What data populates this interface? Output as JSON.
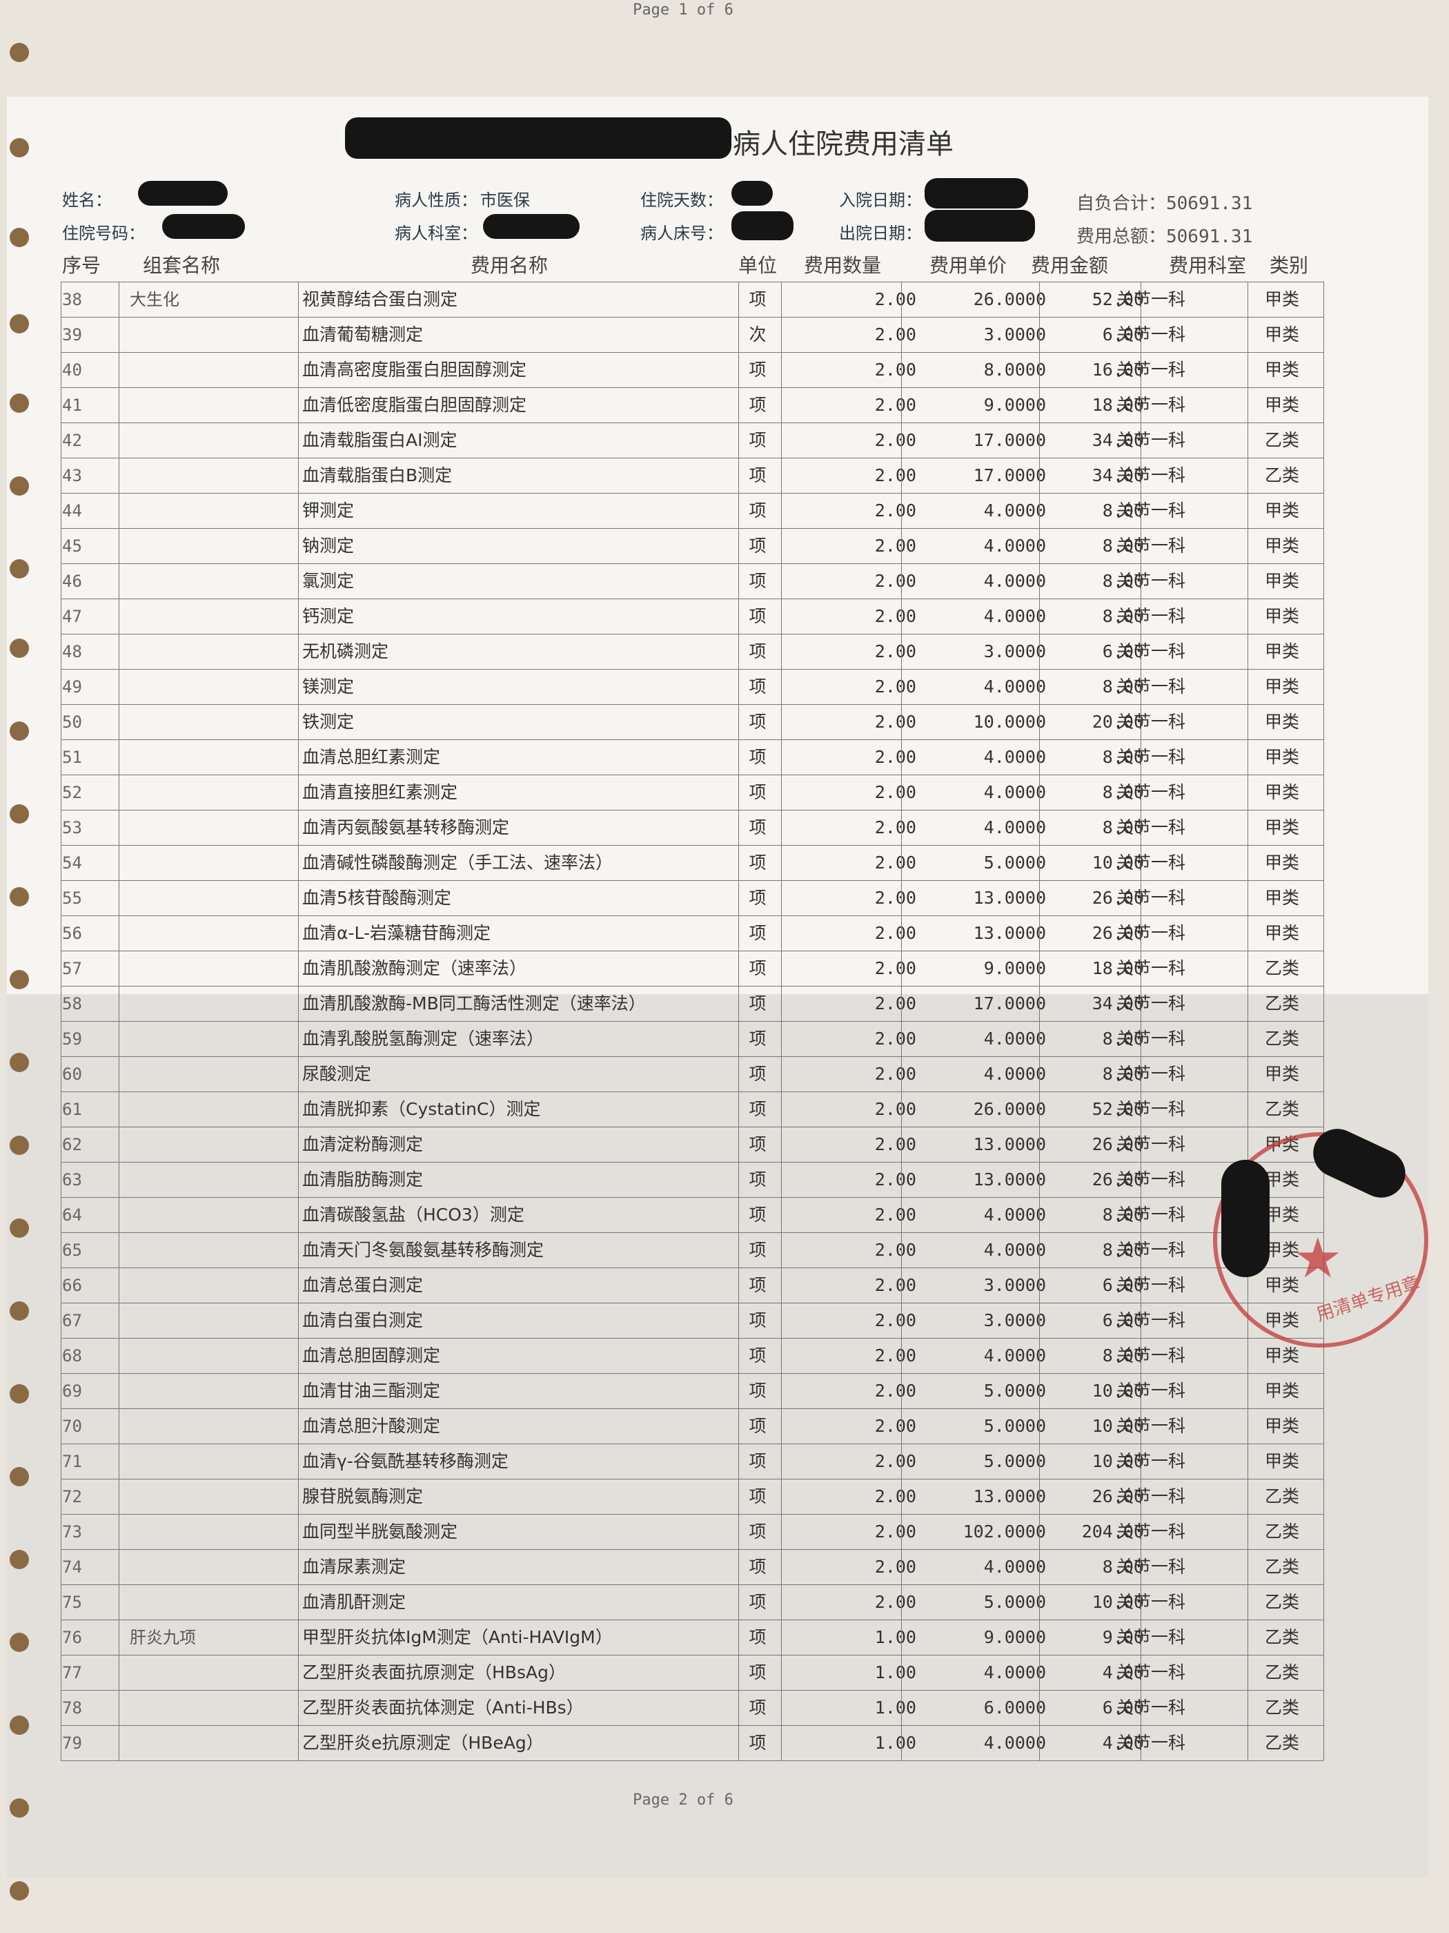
{
  "page_top": "Page 1 of 6",
  "page_bottom": "Page 2 of 6",
  "title": "病人住院费用清单",
  "header": {
    "name_label": "姓名：",
    "nature_label": "病人性质：",
    "nature_value": "市医保",
    "days_label": "住院天数：",
    "admit_label": "入院日期：",
    "self_pay": "自负合计：50691.31",
    "hospital_no_label": "住院号码：",
    "ward_label": "病人科室：",
    "bed_label": "病人床号：",
    "discharge_label": "出院日期：",
    "total": "费用总额：50691.31"
  },
  "columns": {
    "seq": "序号",
    "group": "组套名称",
    "name": "费用名称",
    "unit": "单位",
    "qty": "费用数量",
    "price": "费用单价",
    "amount": "费用金额",
    "dept": "费用科室",
    "category": "类别"
  },
  "rows": [
    {
      "seq": "38",
      "group": "大生化",
      "name": "视黄醇结合蛋白测定",
      "unit": "项",
      "qty": "2.00",
      "price": "26.0000",
      "amount": "52.00",
      "dept": "关节一科",
      "cat": "甲类"
    },
    {
      "seq": "39",
      "group": "",
      "name": "血清葡萄糖测定",
      "unit": "次",
      "qty": "2.00",
      "price": "3.0000",
      "amount": "6.00",
      "dept": "关节一科",
      "cat": "甲类"
    },
    {
      "seq": "40",
      "group": "",
      "name": "血清高密度脂蛋白胆固醇测定",
      "unit": "项",
      "qty": "2.00",
      "price": "8.0000",
      "amount": "16.00",
      "dept": "关节一科",
      "cat": "甲类"
    },
    {
      "seq": "41",
      "group": "",
      "name": "血清低密度脂蛋白胆固醇测定",
      "unit": "项",
      "qty": "2.00",
      "price": "9.0000",
      "amount": "18.00",
      "dept": "关节一科",
      "cat": "甲类"
    },
    {
      "seq": "42",
      "group": "",
      "name": "血清载脂蛋白AⅠ测定",
      "unit": "项",
      "qty": "2.00",
      "price": "17.0000",
      "amount": "34.00",
      "dept": "关节一科",
      "cat": "乙类"
    },
    {
      "seq": "43",
      "group": "",
      "name": "血清载脂蛋白B测定",
      "unit": "项",
      "qty": "2.00",
      "price": "17.0000",
      "amount": "34.00",
      "dept": "关节一科",
      "cat": "乙类"
    },
    {
      "seq": "44",
      "group": "",
      "name": "钾测定",
      "unit": "项",
      "qty": "2.00",
      "price": "4.0000",
      "amount": "8.00",
      "dept": "关节一科",
      "cat": "甲类"
    },
    {
      "seq": "45",
      "group": "",
      "name": "钠测定",
      "unit": "项",
      "qty": "2.00",
      "price": "4.0000",
      "amount": "8.00",
      "dept": "关节一科",
      "cat": "甲类"
    },
    {
      "seq": "46",
      "group": "",
      "name": "氯测定",
      "unit": "项",
      "qty": "2.00",
      "price": "4.0000",
      "amount": "8.00",
      "dept": "关节一科",
      "cat": "甲类"
    },
    {
      "seq": "47",
      "group": "",
      "name": "钙测定",
      "unit": "项",
      "qty": "2.00",
      "price": "4.0000",
      "amount": "8.00",
      "dept": "关节一科",
      "cat": "甲类"
    },
    {
      "seq": "48",
      "group": "",
      "name": "无机磷测定",
      "unit": "项",
      "qty": "2.00",
      "price": "3.0000",
      "amount": "6.00",
      "dept": "关节一科",
      "cat": "甲类"
    },
    {
      "seq": "49",
      "group": "",
      "name": "镁测定",
      "unit": "项",
      "qty": "2.00",
      "price": "4.0000",
      "amount": "8.00",
      "dept": "关节一科",
      "cat": "甲类"
    },
    {
      "seq": "50",
      "group": "",
      "name": "铁测定",
      "unit": "项",
      "qty": "2.00",
      "price": "10.0000",
      "amount": "20.00",
      "dept": "关节一科",
      "cat": "甲类"
    },
    {
      "seq": "51",
      "group": "",
      "name": "血清总胆红素测定",
      "unit": "项",
      "qty": "2.00",
      "price": "4.0000",
      "amount": "8.00",
      "dept": "关节一科",
      "cat": "甲类"
    },
    {
      "seq": "52",
      "group": "",
      "name": "血清直接胆红素测定",
      "unit": "项",
      "qty": "2.00",
      "price": "4.0000",
      "amount": "8.00",
      "dept": "关节一科",
      "cat": "甲类"
    },
    {
      "seq": "53",
      "group": "",
      "name": "血清丙氨酸氨基转移酶测定",
      "unit": "项",
      "qty": "2.00",
      "price": "4.0000",
      "amount": "8.00",
      "dept": "关节一科",
      "cat": "甲类"
    },
    {
      "seq": "54",
      "group": "",
      "name": "血清碱性磷酸酶测定（手工法、速率法）",
      "unit": "项",
      "qty": "2.00",
      "price": "5.0000",
      "amount": "10.00",
      "dept": "关节一科",
      "cat": "甲类"
    },
    {
      "seq": "55",
      "group": "",
      "name": "血清5核苷酸酶测定",
      "unit": "项",
      "qty": "2.00",
      "price": "13.0000",
      "amount": "26.00",
      "dept": "关节一科",
      "cat": "甲类"
    },
    {
      "seq": "56",
      "group": "",
      "name": "血清α-L-岩藻糖苷酶测定",
      "unit": "项",
      "qty": "2.00",
      "price": "13.0000",
      "amount": "26.00",
      "dept": "关节一科",
      "cat": "甲类"
    },
    {
      "seq": "57",
      "group": "",
      "name": "血清肌酸激酶测定（速率法）",
      "unit": "项",
      "qty": "2.00",
      "price": "9.0000",
      "amount": "18.00",
      "dept": "关节一科",
      "cat": "乙类"
    },
    {
      "seq": "58",
      "group": "",
      "name": "血清肌酸激酶-MB同工酶活性测定（速率法）",
      "unit": "项",
      "qty": "2.00",
      "price": "17.0000",
      "amount": "34.00",
      "dept": "关节一科",
      "cat": "乙类"
    },
    {
      "seq": "59",
      "group": "",
      "name": "血清乳酸脱氢酶测定（速率法）",
      "unit": "项",
      "qty": "2.00",
      "price": "4.0000",
      "amount": "8.00",
      "dept": "关节一科",
      "cat": "乙类"
    },
    {
      "seq": "60",
      "group": "",
      "name": "尿酸测定",
      "unit": "项",
      "qty": "2.00",
      "price": "4.0000",
      "amount": "8.00",
      "dept": "关节一科",
      "cat": "甲类"
    },
    {
      "seq": "61",
      "group": "",
      "name": "血清胱抑素（CystatinC）测定",
      "unit": "项",
      "qty": "2.00",
      "price": "26.0000",
      "amount": "52.00",
      "dept": "关节一科",
      "cat": "乙类"
    },
    {
      "seq": "62",
      "group": "",
      "name": "血清淀粉酶测定",
      "unit": "项",
      "qty": "2.00",
      "price": "13.0000",
      "amount": "26.00",
      "dept": "关节一科",
      "cat": "甲类"
    },
    {
      "seq": "63",
      "group": "",
      "name": "血清脂肪酶测定",
      "unit": "项",
      "qty": "2.00",
      "price": "13.0000",
      "amount": "26.00",
      "dept": "关节一科",
      "cat": "甲类"
    },
    {
      "seq": "64",
      "group": "",
      "name": "血清碳酸氢盐（HCO3）测定",
      "unit": "项",
      "qty": "2.00",
      "price": "4.0000",
      "amount": "8.00",
      "dept": "关节一科",
      "cat": "甲类"
    },
    {
      "seq": "65",
      "group": "",
      "name": "血清天门冬氨酸氨基转移酶测定",
      "unit": "项",
      "qty": "2.00",
      "price": "4.0000",
      "amount": "8.00",
      "dept": "关节一科",
      "cat": "甲类"
    },
    {
      "seq": "66",
      "group": "",
      "name": "血清总蛋白测定",
      "unit": "项",
      "qty": "2.00",
      "price": "3.0000",
      "amount": "6.00",
      "dept": "关节一科",
      "cat": "甲类"
    },
    {
      "seq": "67",
      "group": "",
      "name": "血清白蛋白测定",
      "unit": "项",
      "qty": "2.00",
      "price": "3.0000",
      "amount": "6.00",
      "dept": "关节一科",
      "cat": "甲类"
    },
    {
      "seq": "68",
      "group": "",
      "name": "血清总胆固醇测定",
      "unit": "项",
      "qty": "2.00",
      "price": "4.0000",
      "amount": "8.00",
      "dept": "关节一科",
      "cat": "甲类"
    },
    {
      "seq": "69",
      "group": "",
      "name": "血清甘油三酯测定",
      "unit": "项",
      "qty": "2.00",
      "price": "5.0000",
      "amount": "10.00",
      "dept": "关节一科",
      "cat": "甲类"
    },
    {
      "seq": "70",
      "group": "",
      "name": "血清总胆汁酸测定",
      "unit": "项",
      "qty": "2.00",
      "price": "5.0000",
      "amount": "10.00",
      "dept": "关节一科",
      "cat": "甲类"
    },
    {
      "seq": "71",
      "group": "",
      "name": "血清γ-谷氨酰基转移酶测定",
      "unit": "项",
      "qty": "2.00",
      "price": "5.0000",
      "amount": "10.00",
      "dept": "关节一科",
      "cat": "甲类"
    },
    {
      "seq": "72",
      "group": "",
      "name": "腺苷脱氨酶测定",
      "unit": "项",
      "qty": "2.00",
      "price": "13.0000",
      "amount": "26.00",
      "dept": "关节一科",
      "cat": "乙类"
    },
    {
      "seq": "73",
      "group": "",
      "name": "血同型半胱氨酸测定",
      "unit": "项",
      "qty": "2.00",
      "price": "102.0000",
      "amount": "204.00",
      "dept": "关节一科",
      "cat": "乙类"
    },
    {
      "seq": "74",
      "group": "",
      "name": "血清尿素测定",
      "unit": "项",
      "qty": "2.00",
      "price": "4.0000",
      "amount": "8.00",
      "dept": "关节一科",
      "cat": "乙类"
    },
    {
      "seq": "75",
      "group": "",
      "name": "血清肌酐测定",
      "unit": "项",
      "qty": "2.00",
      "price": "5.0000",
      "amount": "10.00",
      "dept": "关节一科",
      "cat": "乙类"
    },
    {
      "seq": "76",
      "group": "肝炎九项",
      "name": "甲型肝炎抗体IgM测定（Anti-HAVIgM）",
      "unit": "项",
      "qty": "1.00",
      "price": "9.0000",
      "amount": "9.00",
      "dept": "关节一科",
      "cat": "乙类"
    },
    {
      "seq": "77",
      "group": "",
      "name": "乙型肝炎表面抗原测定（HBsAg）",
      "unit": "项",
      "qty": "1.00",
      "price": "4.0000",
      "amount": "4.00",
      "dept": "关节一科",
      "cat": "乙类"
    },
    {
      "seq": "78",
      "group": "",
      "name": "乙型肝炎表面抗体测定（Anti-HBs）",
      "unit": "项",
      "qty": "1.00",
      "price": "6.0000",
      "amount": "6.00",
      "dept": "关节一科",
      "cat": "乙类"
    },
    {
      "seq": "79",
      "group": "",
      "name": "乙型肝炎e抗原测定（HBeAg）",
      "unit": "项",
      "qty": "1.00",
      "price": "4.0000",
      "amount": "4.00",
      "dept": "关节一科",
      "cat": "乙类"
    }
  ],
  "stamp": {
    "label": "用清单专用章",
    "star": "★"
  }
}
